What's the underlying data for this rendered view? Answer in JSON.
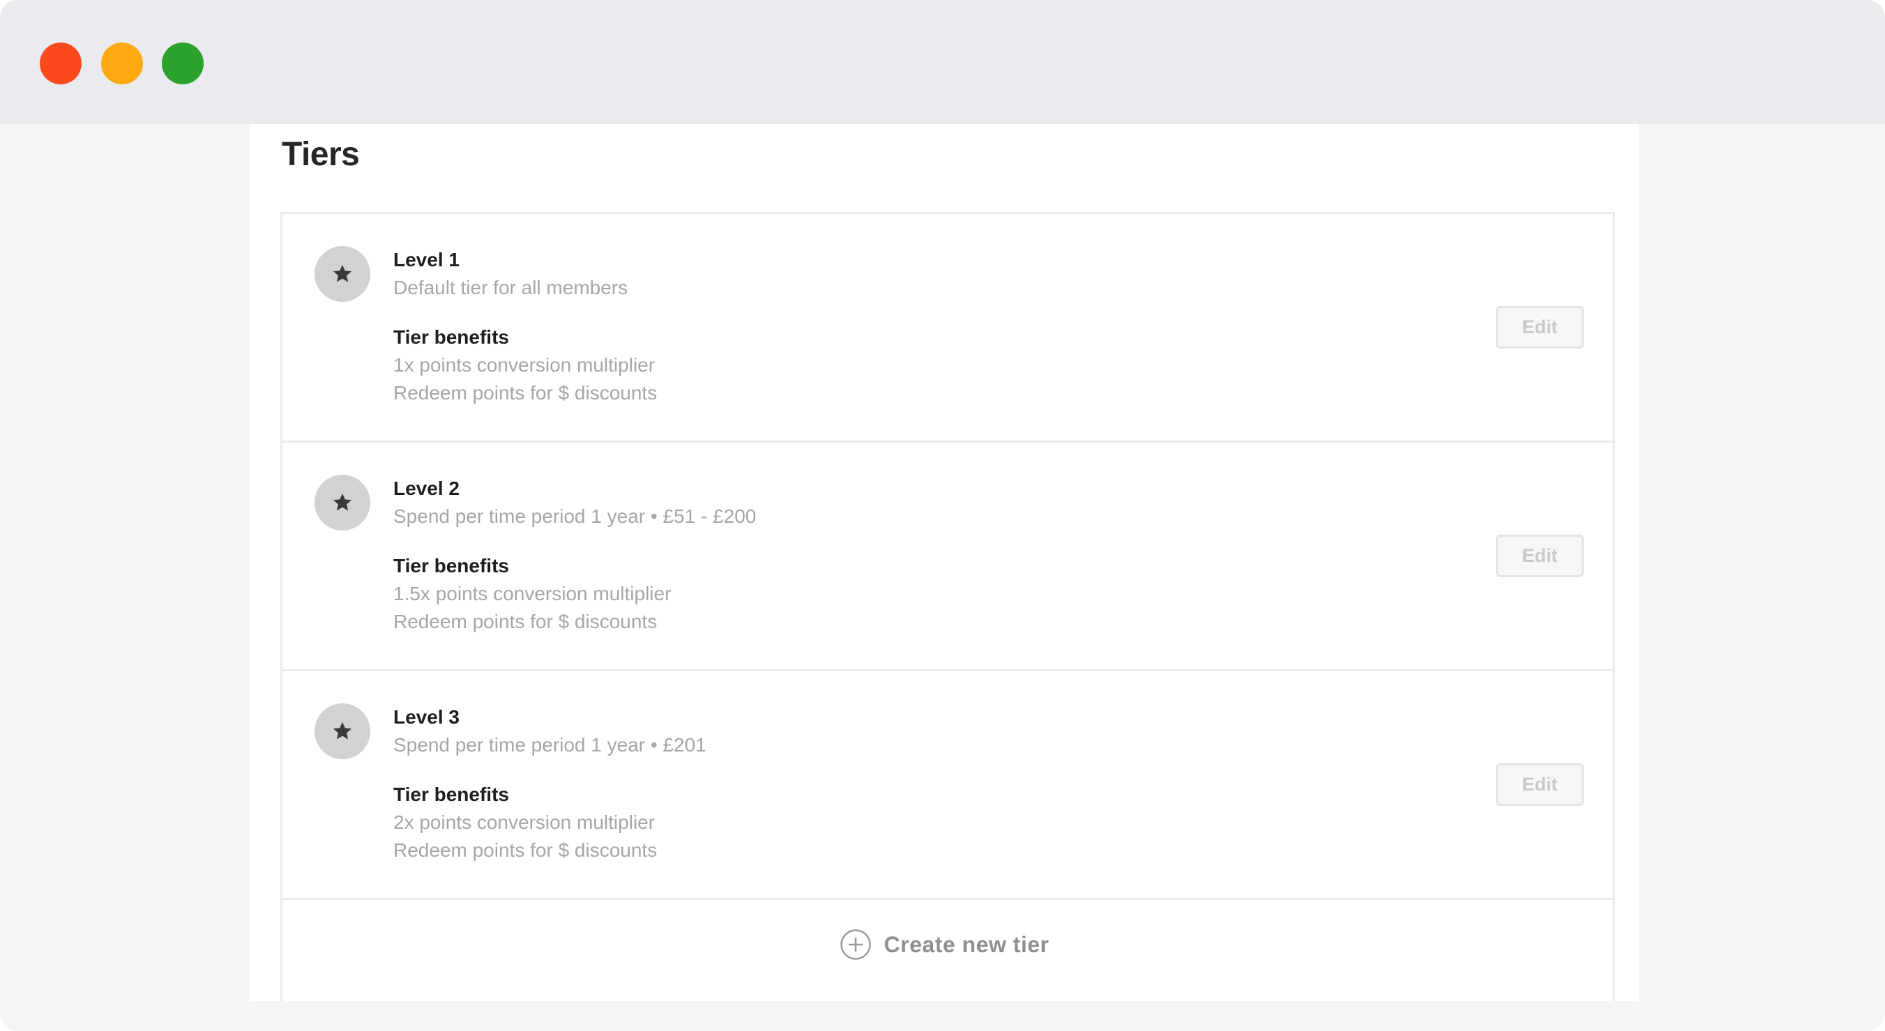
{
  "window": {
    "controls": [
      "close",
      "minimize",
      "maximize"
    ],
    "colors": {
      "close": "#fc4a1f",
      "minimize": "#fdaa10",
      "maximize": "#2aa22b"
    }
  },
  "page": {
    "title": "Tiers"
  },
  "tiers": [
    {
      "icon": "star-icon",
      "name": "Level 1",
      "description": "Default tier for all members",
      "benefits_title": "Tier benefits",
      "benefits": [
        "1x points conversion multiplier",
        "Redeem points for $ discounts"
      ],
      "edit_label": "Edit"
    },
    {
      "icon": "star-icon",
      "name": "Level 2",
      "description": "Spend per time period 1 year • £51 - £200",
      "benefits_title": "Tier benefits",
      "benefits": [
        "1.5x points conversion multiplier",
        "Redeem points for $ discounts"
      ],
      "edit_label": "Edit"
    },
    {
      "icon": "star-icon",
      "name": "Level 3",
      "description": "Spend per time period 1 year • £201",
      "benefits_title": "Tier benefits",
      "benefits": [
        "2x points conversion multiplier",
        "Redeem points for $ discounts"
      ],
      "edit_label": "Edit"
    }
  ],
  "create": {
    "icon": "plus-circle-icon",
    "label": "Create new tier"
  }
}
